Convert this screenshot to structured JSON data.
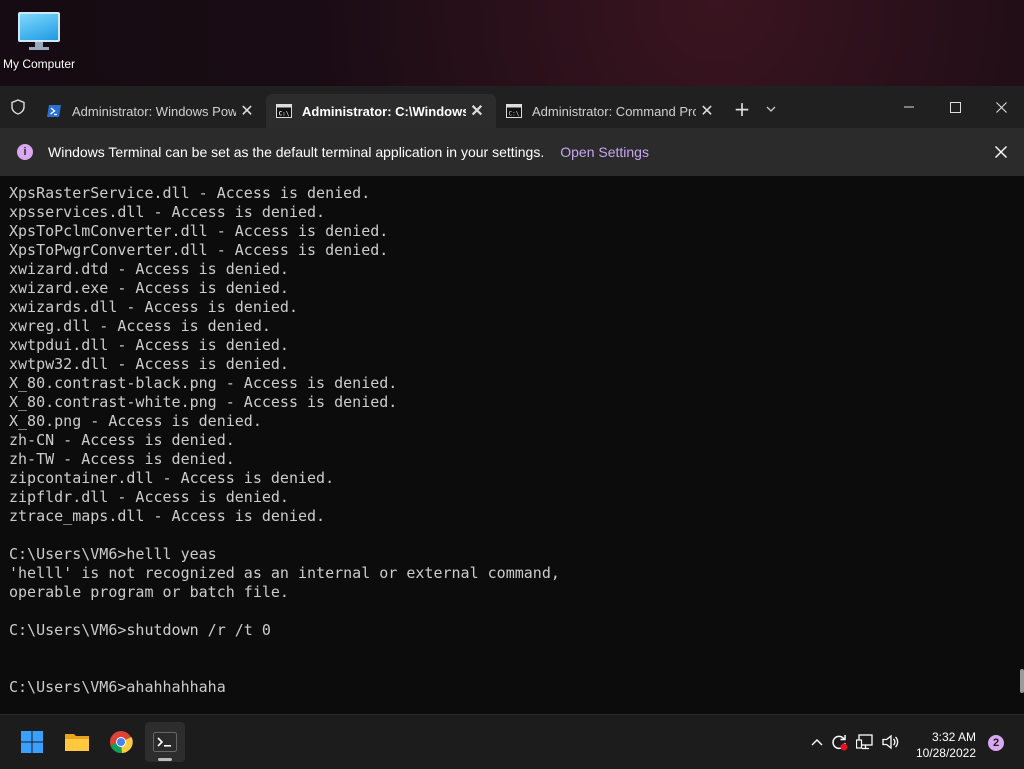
{
  "desktop": {
    "icons": [
      {
        "label": "My Computer",
        "icon": "computer-icon"
      }
    ]
  },
  "terminal": {
    "tabs": [
      {
        "title": "Administrator: Windows Power",
        "icon": "powershell-icon",
        "active": false
      },
      {
        "title": "Administrator:  C:\\Windows\\S",
        "icon": "cmd-icon",
        "active": true
      },
      {
        "title": "Administrator: Command Pron",
        "icon": "cmd-icon",
        "active": false
      }
    ],
    "new_tab_glyph": "+",
    "dropdown_glyph": "⌄",
    "window_controls": {
      "minimize": "—",
      "maximize": "☐",
      "close": "✕"
    },
    "infobar": {
      "message": "Windows Terminal can be set as the default terminal application in your settings.",
      "link": "Open Settings",
      "icon_glyph": "i",
      "close_glyph": "✕"
    },
    "console_lines": [
      "XpsRasterService.dll - Access is denied.",
      "xpsservices.dll - Access is denied.",
      "XpsToPclmConverter.dll - Access is denied.",
      "XpsToPwgrConverter.dll - Access is denied.",
      "xwizard.dtd - Access is denied.",
      "xwizard.exe - Access is denied.",
      "xwizards.dll - Access is denied.",
      "xwreg.dll - Access is denied.",
      "xwtpdui.dll - Access is denied.",
      "xwtpw32.dll - Access is denied.",
      "X_80.contrast-black.png - Access is denied.",
      "X_80.contrast-white.png - Access is denied.",
      "X_80.png - Access is denied.",
      "zh-CN - Access is denied.",
      "zh-TW - Access is denied.",
      "zipcontainer.dll - Access is denied.",
      "zipfldr.dll - Access is denied.",
      "ztrace_maps.dll - Access is denied.",
      "",
      "C:\\Users\\VM6>helll yeas",
      "'helll' is not recognized as an internal or external command,",
      "operable program or batch file.",
      "",
      "C:\\Users\\VM6>shutdown /r /t 0",
      "",
      "",
      "C:\\Users\\VM6>ahahhahhaha"
    ]
  },
  "taskbar": {
    "apps": [
      {
        "name": "start",
        "icon": "windows-start-icon"
      },
      {
        "name": "file-explorer",
        "icon": "folder-icon"
      },
      {
        "name": "chrome",
        "icon": "chrome-icon"
      },
      {
        "name": "terminal",
        "icon": "terminal-icon"
      }
    ],
    "tray": {
      "chevron_glyph": "^",
      "time": "3:32 AM",
      "date": "10/28/2022",
      "notification_count": "2"
    }
  },
  "colors": {
    "accent": "#d9a8f0",
    "link": "#c7a6f0",
    "console_bg": "#0c0c0c",
    "console_text": "#cccccc"
  }
}
